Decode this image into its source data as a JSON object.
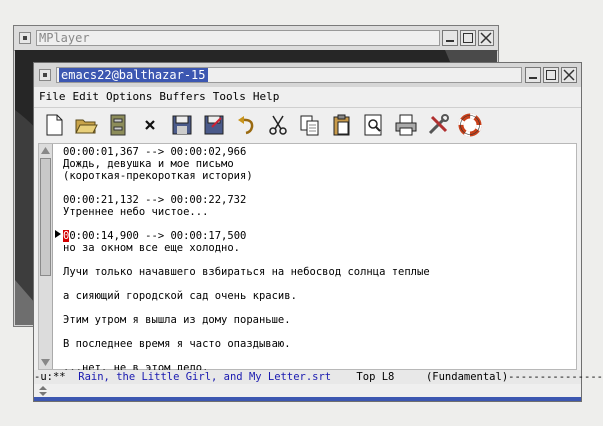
{
  "back_window": {
    "title": "MPlayer"
  },
  "emacs": {
    "title": "emacs22@balthazar-15",
    "menu": [
      "File",
      "Edit",
      "Options",
      "Buffers",
      "Tools",
      "Help"
    ],
    "toolbar_icons": [
      "new-file-icon",
      "open-folder-icon",
      "open-directory-icon",
      "close-icon",
      "save-icon",
      "save-as-icon",
      "undo-icon",
      "cut-icon",
      "copy-icon",
      "paste-icon",
      "search-icon",
      "print-icon",
      "preferences-icon",
      "help-icon"
    ],
    "lines": [
      "00:00:01,367 --> 00:00:02,966",
      "Дождь, девушка и мое письмо",
      "(короткая-прекороткая история)",
      "",
      "00:00:21,132 --> 00:00:22,732",
      "Утреннее небо чистое...",
      "",
      "00:00:14,900 --> 00:00:17,500",
      "но за окном все еще холодно.",
      "",
      "Лучи только начавшего взбираться на небосвод солнца теплые",
      "",
      "а сияющий городской сад очень красив.",
      "",
      "Этим утром я вышла из дому пораньше.",
      "",
      "В последнее время я часто опаздываю.",
      "",
      "...нет, не в этом дело."
    ],
    "cursor_line_rest": "0:00:14,900 --> 00:00:17,500",
    "cursor_char": "0",
    "modeline": {
      "prefix": "-u:**  ",
      "buffer": "Rain, the Little Girl, and My Letter.srt",
      "position": "    Top L8     (Fundamental)-----------------"
    }
  }
}
